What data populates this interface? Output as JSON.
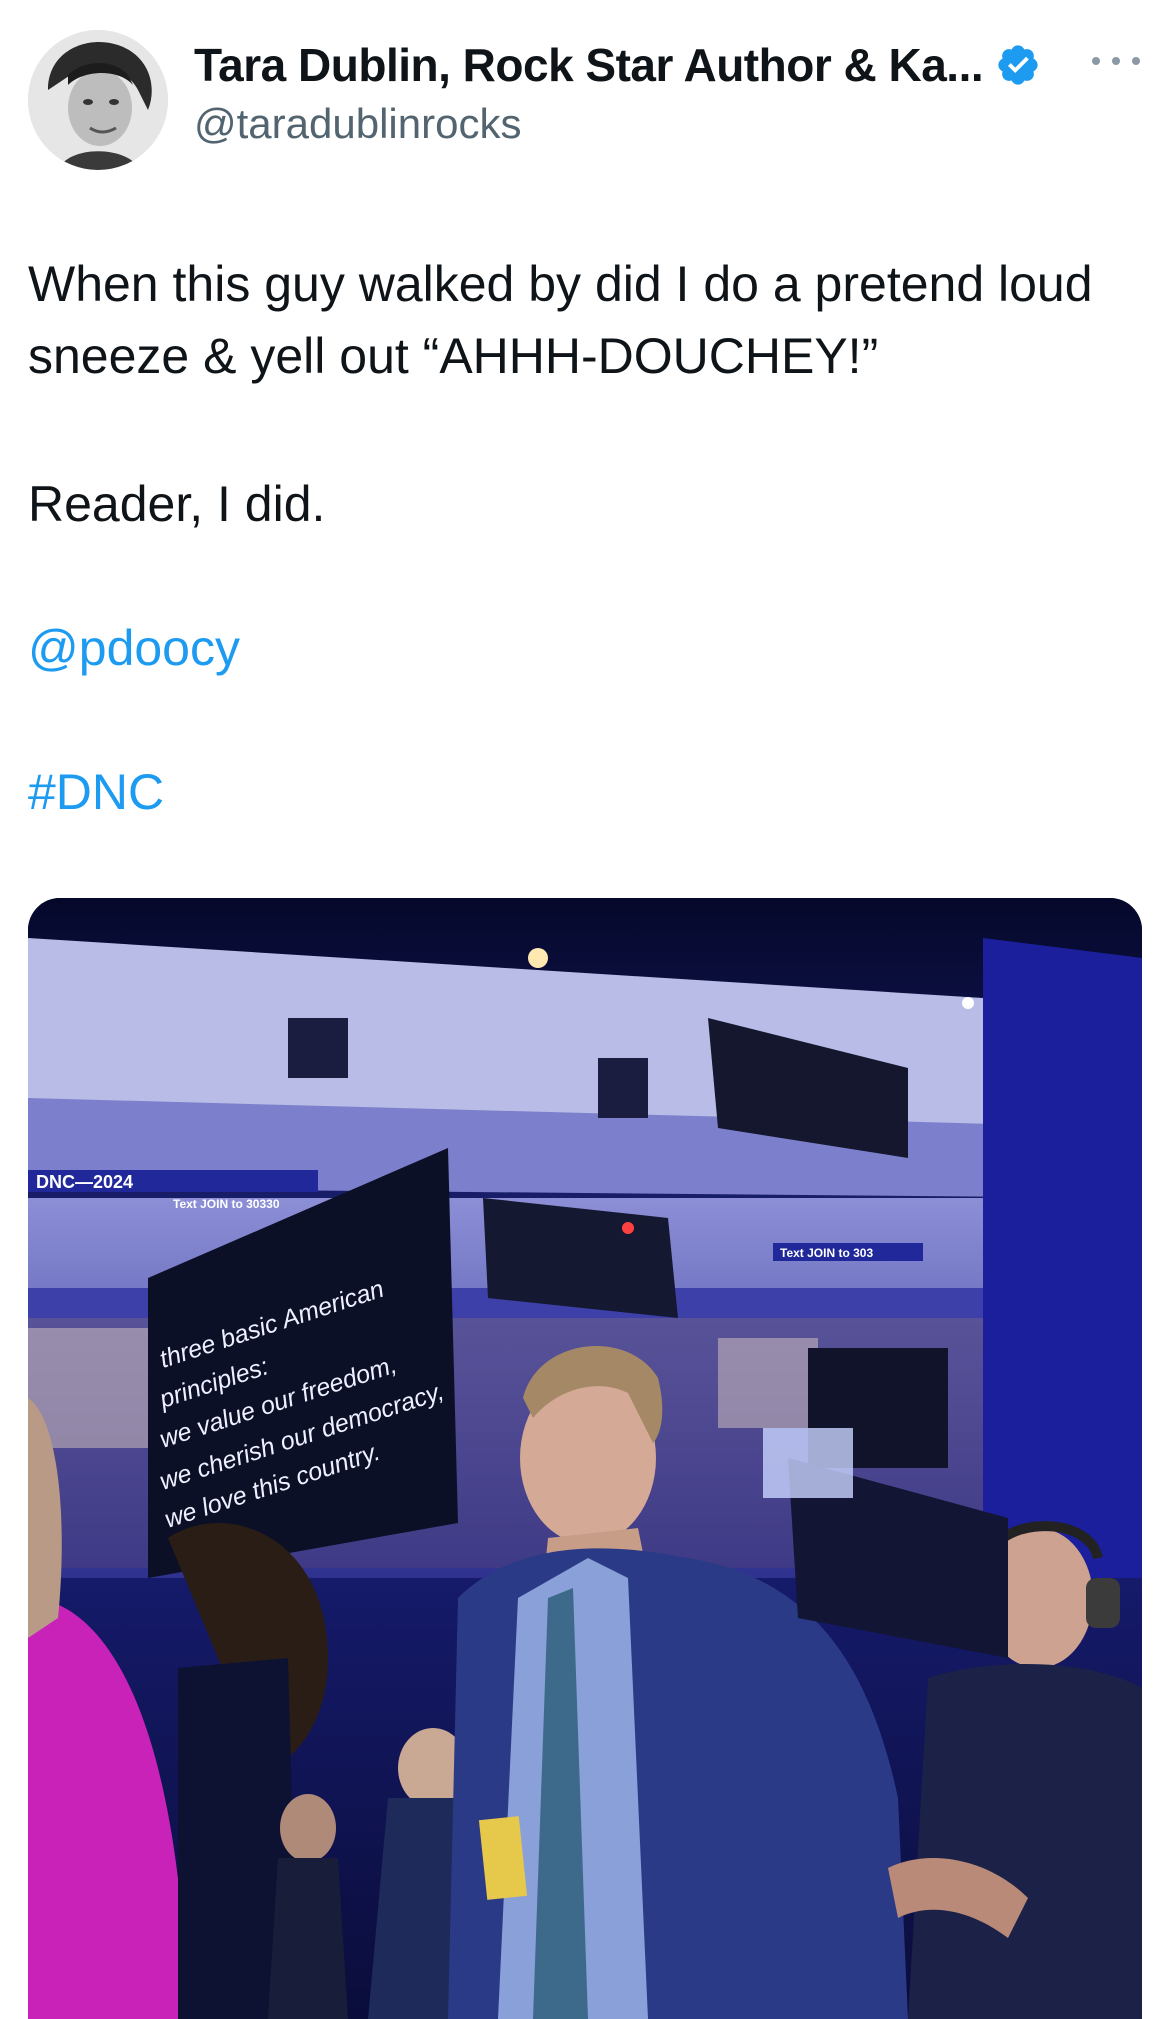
{
  "author": {
    "display_name": "Tara Dublin, Rock Star Author & Ka...",
    "handle": "@taradublinrocks",
    "verified": true,
    "verified_color": "#1d9bf0"
  },
  "tweet": {
    "text_line_1": "When this guy walked by did I do a pretend loud sneeze & yell out “AHHH-DOUCHEY!”",
    "text_line_2": "Reader, I did.",
    "mention": "@pdoocy",
    "hashtag": "#DNC"
  },
  "media": {
    "screen_banner": "DNC—2024",
    "screen_text_join": "Text JOIN to 30330",
    "screen_caption_1": "three basic American",
    "screen_caption_2": "principles:",
    "screen_caption_3": "we value our freedom,",
    "screen_caption_4": "we cherish our democracy,",
    "screen_caption_5": "we love this country.",
    "right_banner": "Text JOIN to 303",
    "link_color": "#1d9bf0"
  },
  "icons": {
    "more": "more-horizontal-icon",
    "verified": "verified-badge-icon"
  }
}
